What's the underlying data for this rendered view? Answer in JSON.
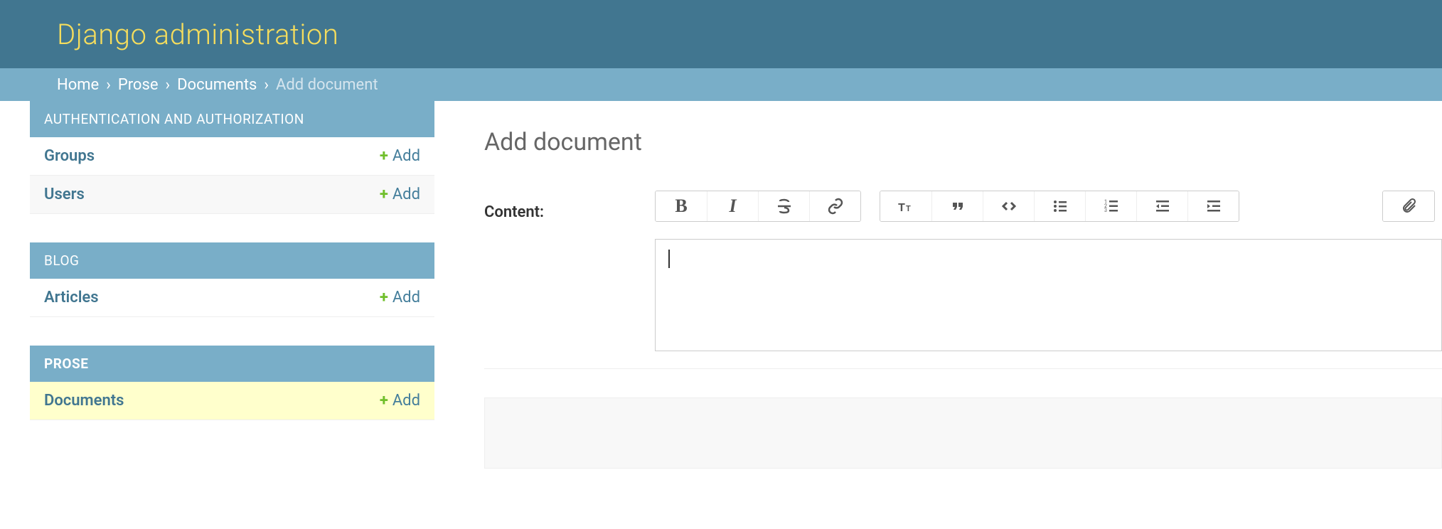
{
  "header": {
    "title": "Django administration"
  },
  "breadcrumbs": {
    "items": [
      {
        "label": "Home"
      },
      {
        "label": "Prose"
      },
      {
        "label": "Documents"
      }
    ],
    "current": "Add document",
    "separator": "›"
  },
  "sidebar": {
    "add_label": "Add",
    "modules": [
      {
        "caption": "AUTHENTICATION AND AUTHORIZATION",
        "rows": [
          {
            "label": "Groups"
          },
          {
            "label": "Users"
          }
        ]
      },
      {
        "caption": "BLOG",
        "rows": [
          {
            "label": "Articles"
          }
        ]
      },
      {
        "caption": "PROSE",
        "current_app": true,
        "rows": [
          {
            "label": "Documents",
            "current_model": true
          }
        ]
      }
    ]
  },
  "main": {
    "page_title": "Add document",
    "field_label": "Content:",
    "content_value": ""
  },
  "icons": {
    "bold": "B",
    "italic": "I"
  }
}
